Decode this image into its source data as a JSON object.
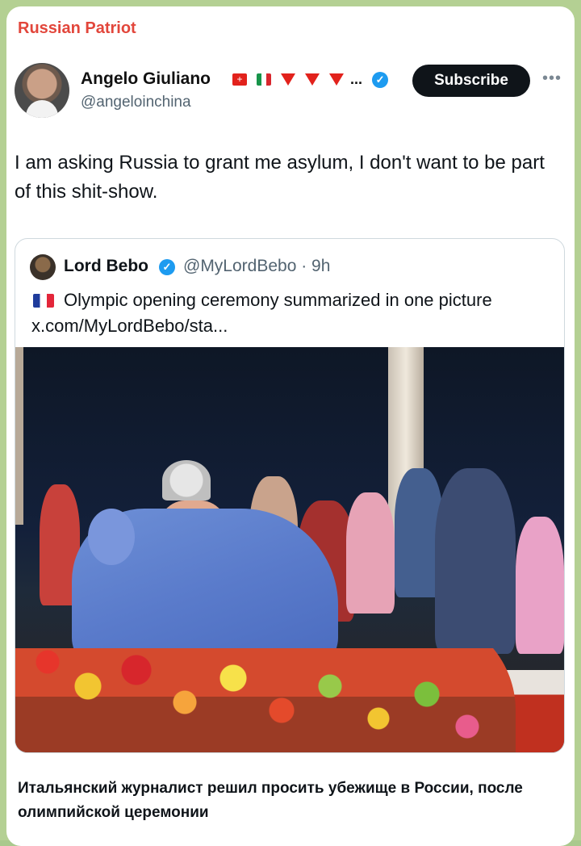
{
  "channel": {
    "name": "Russian Patriot"
  },
  "post": {
    "author": "Angelo Giuliano",
    "handle": "@angeloinchina",
    "name_suffix": "...",
    "subscribe_label": "Subscribe",
    "more_label": "•••",
    "text": "I am asking Russia to grant me asylum, I don't want to be part of this shit-show.",
    "icons": [
      "swiss-flag-icon",
      "italian-flag-icon",
      "red-triangle-icon",
      "red-triangle-icon",
      "red-triangle-icon",
      "verified-badge-icon"
    ]
  },
  "quote": {
    "author": "Lord Bebo",
    "handle_time": "@MyLordBebo · 9h",
    "text": "Olympic opening ceremony summarized in one picture",
    "link": "x.com/MyLordBebo/sta...",
    "flag_icon": "french-flag-icon"
  },
  "caption": "Итальянский журналист решил просить убежище в России, после олимпийской церемонии",
  "colors": {
    "channel": "#e2463b",
    "verified": "#1d9bf0",
    "subscribe_bg": "#0f1419"
  }
}
